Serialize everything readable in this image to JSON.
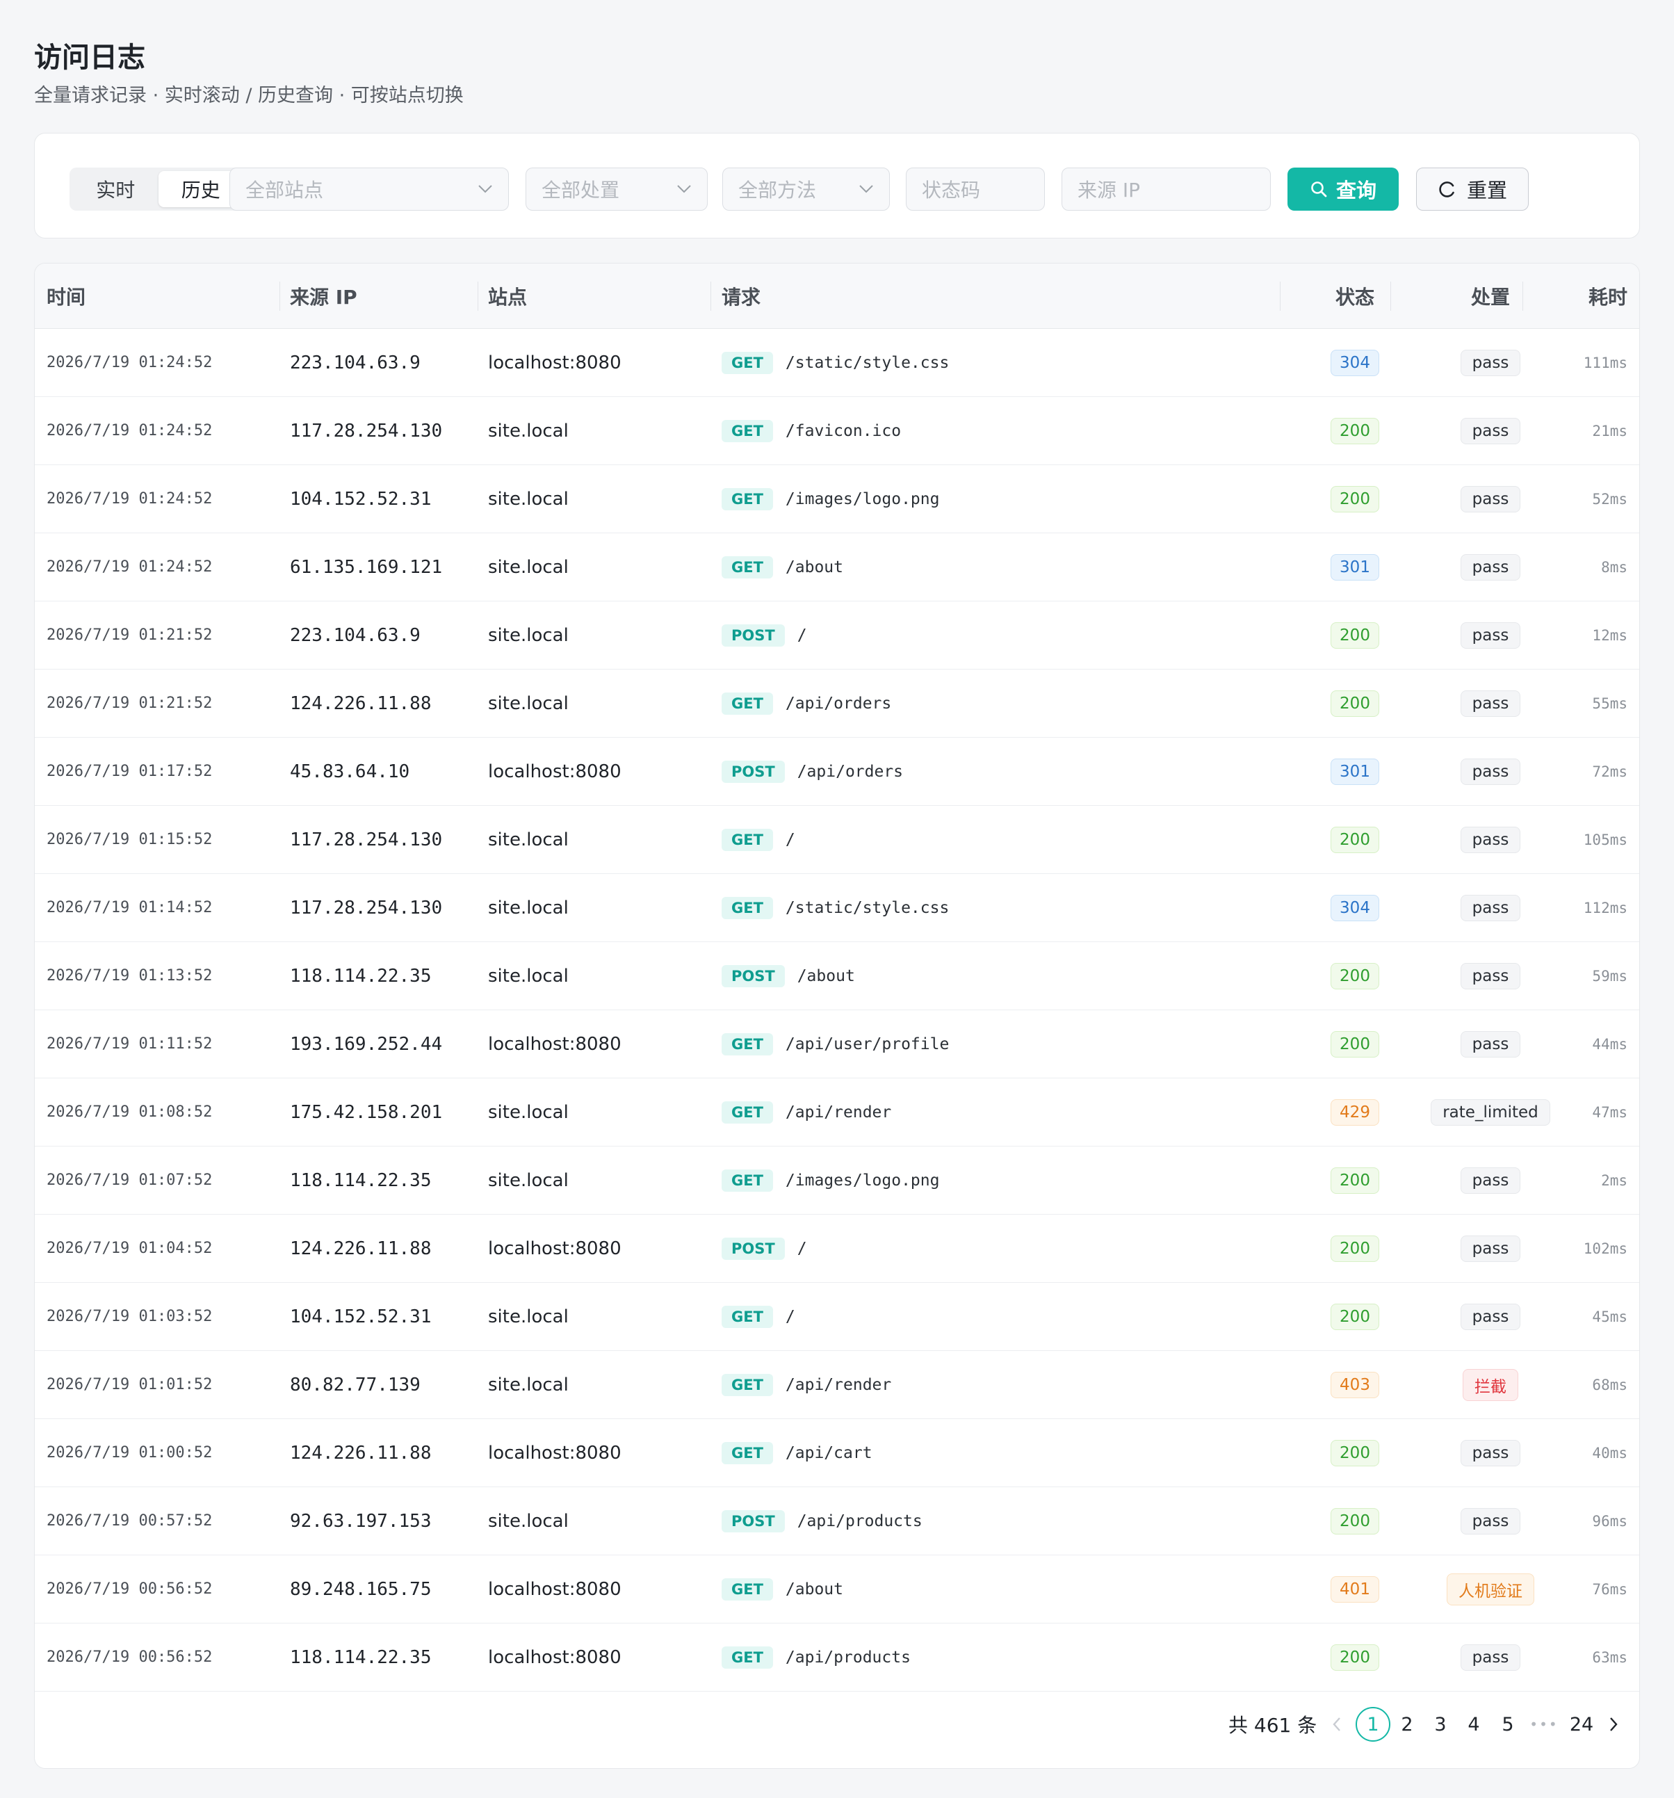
{
  "header": {
    "title": "访问日志",
    "subtitle": "全量请求记录 · 实时滚动 / 历史查询 · 可按站点切换"
  },
  "filters": {
    "mode_realtime": "实时",
    "mode_history": "历史",
    "site_placeholder": "全部站点",
    "action_placeholder": "全部处置",
    "method_placeholder": "全部方法",
    "status_placeholder": "状态码",
    "ip_placeholder": "来源 IP",
    "query_label": "查询",
    "reset_label": "重置"
  },
  "table": {
    "columns": {
      "time": "时间",
      "ip": "来源 IP",
      "site": "站点",
      "request": "请求",
      "status": "状态",
      "action": "处置",
      "duration": "耗时"
    },
    "rows": [
      {
        "time": "2026/7/19 01:24:52",
        "ip": "223.104.63.9",
        "site": "localhost:8080",
        "method": "GET",
        "path": "/static/style.css",
        "status": "304",
        "action": "pass",
        "duration": "111ms"
      },
      {
        "time": "2026/7/19 01:24:52",
        "ip": "117.28.254.130",
        "site": "site.local",
        "method": "GET",
        "path": "/favicon.ico",
        "status": "200",
        "action": "pass",
        "duration": "21ms"
      },
      {
        "time": "2026/7/19 01:24:52",
        "ip": "104.152.52.31",
        "site": "site.local",
        "method": "GET",
        "path": "/images/logo.png",
        "status": "200",
        "action": "pass",
        "duration": "52ms"
      },
      {
        "time": "2026/7/19 01:24:52",
        "ip": "61.135.169.121",
        "site": "site.local",
        "method": "GET",
        "path": "/about",
        "status": "301",
        "action": "pass",
        "duration": "8ms"
      },
      {
        "time": "2026/7/19 01:21:52",
        "ip": "223.104.63.9",
        "site": "site.local",
        "method": "POST",
        "path": "/",
        "status": "200",
        "action": "pass",
        "duration": "12ms"
      },
      {
        "time": "2026/7/19 01:21:52",
        "ip": "124.226.11.88",
        "site": "site.local",
        "method": "GET",
        "path": "/api/orders",
        "status": "200",
        "action": "pass",
        "duration": "55ms"
      },
      {
        "time": "2026/7/19 01:17:52",
        "ip": "45.83.64.10",
        "site": "localhost:8080",
        "method": "POST",
        "path": "/api/orders",
        "status": "301",
        "action": "pass",
        "duration": "72ms"
      },
      {
        "time": "2026/7/19 01:15:52",
        "ip": "117.28.254.130",
        "site": "site.local",
        "method": "GET",
        "path": "/",
        "status": "200",
        "action": "pass",
        "duration": "105ms"
      },
      {
        "time": "2026/7/19 01:14:52",
        "ip": "117.28.254.130",
        "site": "site.local",
        "method": "GET",
        "path": "/static/style.css",
        "status": "304",
        "action": "pass",
        "duration": "112ms"
      },
      {
        "time": "2026/7/19 01:13:52",
        "ip": "118.114.22.35",
        "site": "site.local",
        "method": "POST",
        "path": "/about",
        "status": "200",
        "action": "pass",
        "duration": "59ms"
      },
      {
        "time": "2026/7/19 01:11:52",
        "ip": "193.169.252.44",
        "site": "localhost:8080",
        "method": "GET",
        "path": "/api/user/profile",
        "status": "200",
        "action": "pass",
        "duration": "44ms"
      },
      {
        "time": "2026/7/19 01:08:52",
        "ip": "175.42.158.201",
        "site": "site.local",
        "method": "GET",
        "path": "/api/render",
        "status": "429",
        "action": "rate_limited",
        "duration": "47ms"
      },
      {
        "time": "2026/7/19 01:07:52",
        "ip": "118.114.22.35",
        "site": "site.local",
        "method": "GET",
        "path": "/images/logo.png",
        "status": "200",
        "action": "pass",
        "duration": "2ms"
      },
      {
        "time": "2026/7/19 01:04:52",
        "ip": "124.226.11.88",
        "site": "localhost:8080",
        "method": "POST",
        "path": "/",
        "status": "200",
        "action": "pass",
        "duration": "102ms"
      },
      {
        "time": "2026/7/19 01:03:52",
        "ip": "104.152.52.31",
        "site": "site.local",
        "method": "GET",
        "path": "/",
        "status": "200",
        "action": "pass",
        "duration": "45ms"
      },
      {
        "time": "2026/7/19 01:01:52",
        "ip": "80.82.77.139",
        "site": "site.local",
        "method": "GET",
        "path": "/api/render",
        "status": "403",
        "action": "拦截",
        "duration": "68ms"
      },
      {
        "time": "2026/7/19 01:00:52",
        "ip": "124.226.11.88",
        "site": "localhost:8080",
        "method": "GET",
        "path": "/api/cart",
        "status": "200",
        "action": "pass",
        "duration": "40ms"
      },
      {
        "time": "2026/7/19 00:57:52",
        "ip": "92.63.197.153",
        "site": "site.local",
        "method": "POST",
        "path": "/api/products",
        "status": "200",
        "action": "pass",
        "duration": "96ms"
      },
      {
        "time": "2026/7/19 00:56:52",
        "ip": "89.248.165.75",
        "site": "localhost:8080",
        "method": "GET",
        "path": "/about",
        "status": "401",
        "action": "人机验证",
        "duration": "76ms"
      },
      {
        "time": "2026/7/19 00:56:52",
        "ip": "118.114.22.35",
        "site": "localhost:8080",
        "method": "GET",
        "path": "/api/products",
        "status": "200",
        "action": "pass",
        "duration": "63ms"
      }
    ]
  },
  "pagination": {
    "total": "共 461 条",
    "pages": [
      "1",
      "2",
      "3",
      "4",
      "5",
      "24"
    ],
    "current": "1",
    "ellipsis": "•••",
    "prev_icon": "chevron-left-icon",
    "next_icon": "chevron-right-icon"
  },
  "colors": {
    "accent": "#14b8a6",
    "status_2xx": "#2f9e2f",
    "status_3xx": "#2b74c8",
    "status_4xx": "#e27b1b",
    "blocked": "#e0353d"
  }
}
